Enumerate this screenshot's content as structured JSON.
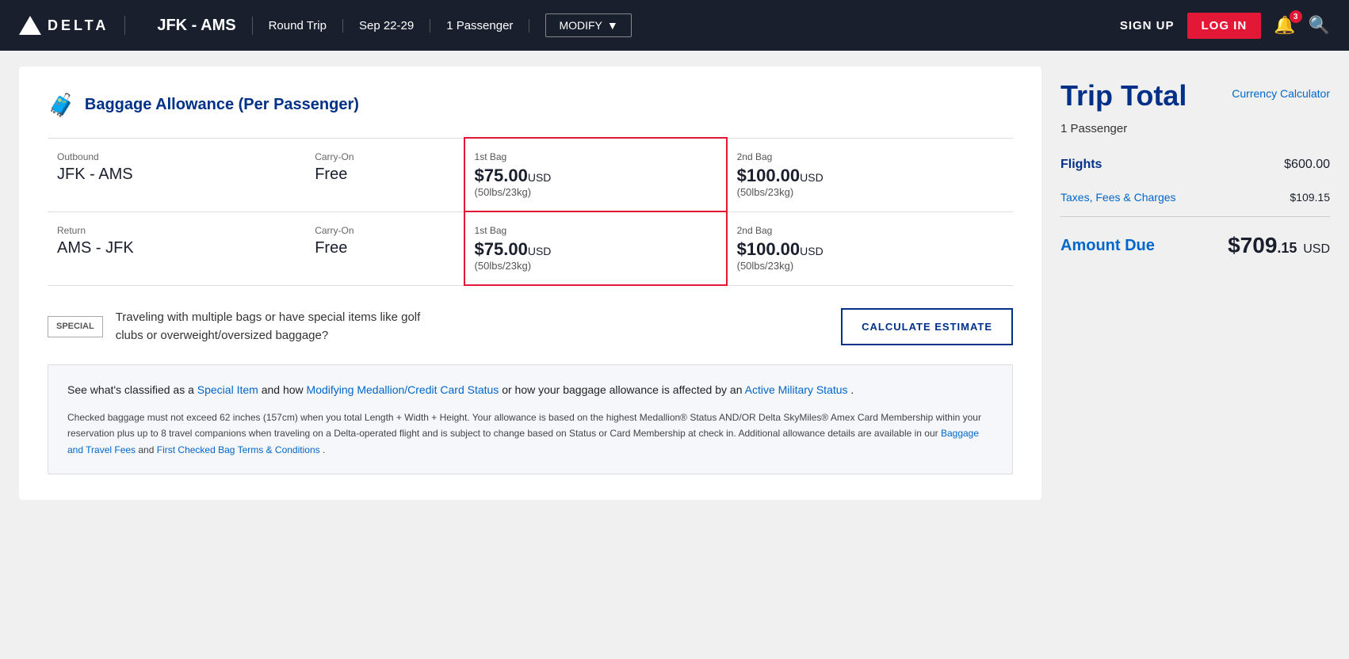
{
  "header": {
    "logo_text": "DELTA",
    "route": "JFK - AMS",
    "trip_type": "Round Trip",
    "dates": "Sep 22-29",
    "passengers": "1 Passenger",
    "modify_label": "MODIFY",
    "signup_label": "SIGN UP",
    "login_label": "LOG IN",
    "bell_count": "3"
  },
  "baggage": {
    "title": "Baggage Allowance (Per Passenger)",
    "outbound_label": "Outbound",
    "outbound_route": "JFK - AMS",
    "return_label": "Return",
    "return_route": "AMS - JFK",
    "carryon_label": "Carry-On",
    "carryon_value": "Free",
    "bag1_label": "1st Bag",
    "bag1_price": "$75.00",
    "bag1_usd": "USD",
    "bag1_weight": "(50lbs/23kg)",
    "bag2_label": "2nd Bag",
    "bag2_price": "$100.00",
    "bag2_usd": "USD",
    "bag2_weight": "(50lbs/23kg)"
  },
  "special": {
    "icon_line1": "SPECIAL",
    "text": "Traveling with multiple bags or have special items like golf clubs or overweight/oversized baggage?",
    "calc_btn": "CALCULATE ESTIMATE"
  },
  "info": {
    "main_text_before1": "See what's classified as a ",
    "link1": "Special Item",
    "main_text_between1": " and how ",
    "link2": "Modifying Medallion/Credit Card Status",
    "main_text_between2": " or how your baggage allowance is affected by an ",
    "link3": "Active Military Status",
    "main_text_after": " .",
    "sub_text": "Checked baggage must not exceed 62 inches (157cm) when you total Length + Width + Height. Your allowance is based on the highest Medallion® Status AND/OR Delta SkyMiles® Amex Card Membership within your reservation plus up to 8 travel companions when traveling on a Delta-operated flight and is subject to change based on Status or Card Membership at check in. Additional allowance details are available in our ",
    "link4": "Baggage and Travel Fees",
    "sub_text2": " and ",
    "link5": "First Checked Bag Terms & Conditions",
    "sub_text3": " ."
  },
  "trip_total": {
    "title": "Trip Total",
    "currency_calc": "Currency Calculator",
    "passengers": "1 Passenger",
    "flights_label": "Flights",
    "flights_value": "$600.00",
    "taxes_label": "Taxes, Fees & Charges",
    "taxes_value": "$109.15",
    "amount_due_label": "Amount Due",
    "amount_due_dollars": "$709",
    "amount_due_cents": ".15",
    "amount_due_usd": "USD"
  }
}
